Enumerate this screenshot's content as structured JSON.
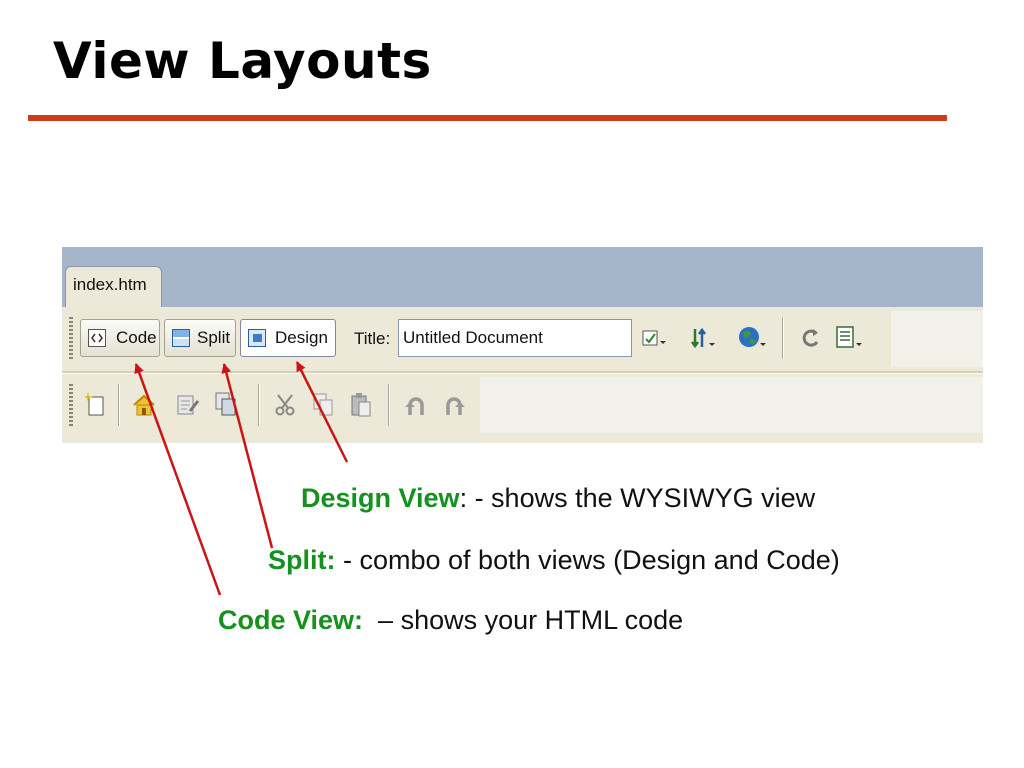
{
  "slide": {
    "title": "View Layouts"
  },
  "editor": {
    "doc_tab": "index.htm",
    "view_buttons": {
      "code": "Code",
      "split": "Split",
      "design": "Design"
    },
    "title_label": "Title:",
    "title_value": "Untitled Document"
  },
  "annotations": {
    "design_term": "Design View",
    "design_desc": ": - shows the WYSIWYG view",
    "split_term": "Split:",
    "split_desc": " - combo of both views (Design and Code)",
    "code_term": "Code View:",
    "code_desc": "  – shows your HTML code"
  },
  "colors": {
    "title_rule": "#c8401a",
    "term_green": "#16911f",
    "arrow_red": "#cc1414"
  },
  "icons": [
    "code-view-icon",
    "split-view-icon",
    "design-view-icon",
    "validate-icon",
    "file-management-icon",
    "browser-preview-icon",
    "refresh-icon",
    "view-options-icon",
    "new-document-icon",
    "home-icon",
    "edit-icon",
    "copy-pages-icon",
    "cut-icon",
    "copy-icon",
    "paste-icon",
    "undo-icon",
    "redo-icon"
  ]
}
